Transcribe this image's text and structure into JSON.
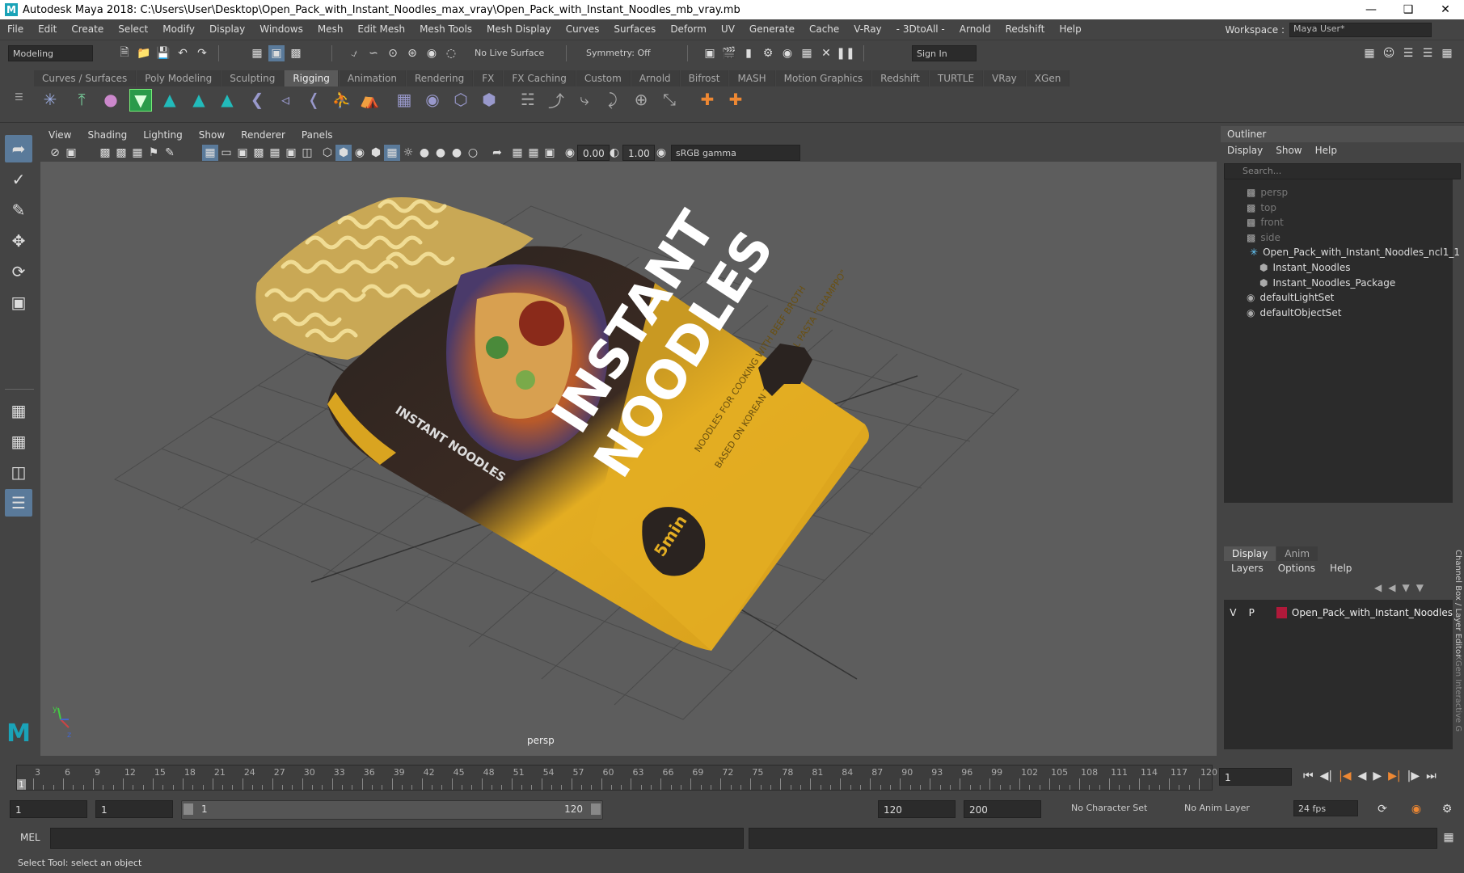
{
  "title": "Autodesk Maya 2018: C:\\Users\\User\\Desktop\\Open_Pack_with_Instant_Noodles_max_vray\\Open_Pack_with_Instant_Noodles_mb_vray.mb",
  "menus": [
    "File",
    "Edit",
    "Create",
    "Select",
    "Modify",
    "Display",
    "Windows",
    "Mesh",
    "Edit Mesh",
    "Mesh Tools",
    "Mesh Display",
    "Curves",
    "Surfaces",
    "Deform",
    "UV",
    "Generate",
    "Cache",
    "V-Ray",
    "- 3DtoAll -",
    "Arnold",
    "Redshift",
    "Help"
  ],
  "workspace": {
    "label": "Workspace :",
    "value": "Maya User*"
  },
  "toolbar": {
    "mode": "Modeling",
    "live_surface": "No Live Surface",
    "symmetry": "Symmetry: Off",
    "sign_in": "Sign In"
  },
  "shelf_tabs": [
    "Curves / Surfaces",
    "Poly Modeling",
    "Sculpting",
    "Rigging",
    "Animation",
    "Rendering",
    "FX",
    "FX Caching",
    "Custom",
    "Arnold",
    "Bifrost",
    "MASH",
    "Motion Graphics",
    "Redshift",
    "TURTLE",
    "VRay",
    "XGen"
  ],
  "active_shelf_tab": "Rigging",
  "viewport": {
    "menus": [
      "View",
      "Shading",
      "Lighting",
      "Show",
      "Renderer",
      "Panels"
    ],
    "exposure": "0.00",
    "gamma": "1.00",
    "color_space": "sRGB gamma",
    "camera_label": "persp",
    "package": {
      "title_line1": "INSTANT",
      "title_line2": "NOODLES",
      "side_text": "INSTANT NOODLES",
      "sub1": "NOODLES FOR COOKING WITH BEEF BROTH",
      "sub2": "BASED ON KOREAN TRADITIONAL PASTA \"CHAMPPO\"",
      "timer": "5min"
    },
    "colors": {
      "package_yellow": "#e3ad22",
      "package_dark": "#2a2320",
      "noodle": "#e8d489",
      "grid_bg": "#5d5d5d"
    }
  },
  "outliner": {
    "title": "Outliner",
    "menus": [
      "Display",
      "Show",
      "Help"
    ],
    "search_placeholder": "Search...",
    "items": [
      {
        "label": "persp",
        "dim": true
      },
      {
        "label": "top",
        "dim": true
      },
      {
        "label": "front",
        "dim": true
      },
      {
        "label": "side",
        "dim": true
      },
      {
        "label": "Open_Pack_with_Instant_Noodles_ncl1_1",
        "dim": false
      },
      {
        "label": "Instant_Noodles",
        "dim": false
      },
      {
        "label": "Instant_Noodles_Package",
        "dim": false
      },
      {
        "label": "defaultLightSet",
        "dim": false
      },
      {
        "label": "defaultObjectSet",
        "dim": false
      }
    ]
  },
  "channel_box": {
    "tabs": [
      "Display",
      "Anim"
    ],
    "menus": [
      "Layers",
      "Options",
      "Help"
    ],
    "layer": {
      "v": "V",
      "p": "P",
      "name": "Open_Pack_with_Instant_Noodles",
      "color": "#b0193a"
    },
    "side_label": "Channel Box / Layer Editor",
    "side_label2": "XGen Interactive G"
  },
  "timeline": {
    "ticks": [
      "3",
      "6",
      "9",
      "12",
      "15",
      "18",
      "21",
      "24",
      "27",
      "30",
      "33",
      "36",
      "39",
      "42",
      "45",
      "48",
      "51",
      "54",
      "57",
      "60",
      "63",
      "66",
      "69",
      "72",
      "75",
      "78",
      "81",
      "84",
      "87",
      "90",
      "93",
      "96",
      "99",
      "102",
      "105",
      "108",
      "111",
      "114",
      "117",
      "120"
    ],
    "current_frame_label": "1",
    "current_frame": "1"
  },
  "range": {
    "start": "1",
    "playback_start": "1",
    "slider_start": "1",
    "slider_end": "120",
    "playback_end": "120",
    "end": "200",
    "character_set": "No Character Set",
    "anim_layer": "No Anim Layer",
    "fps": "24 fps"
  },
  "mel": {
    "label": "MEL"
  },
  "status": "Select Tool: select an object"
}
